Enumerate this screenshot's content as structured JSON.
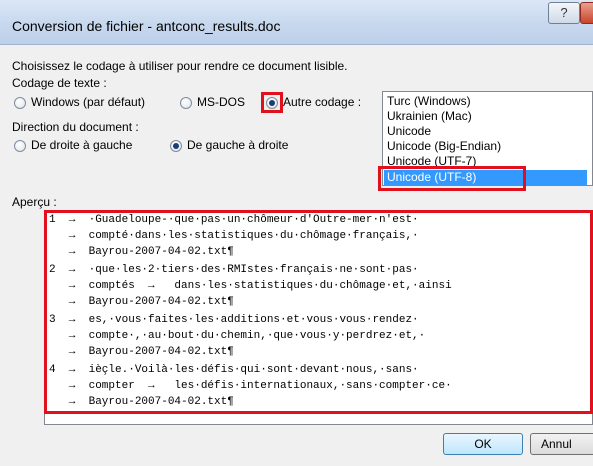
{
  "window": {
    "title": "Conversion de fichier - antconc_results.doc",
    "help_label": "?"
  },
  "instruction": "Choisissez le codage à utiliser pour rendre ce document lisible.",
  "encoding": {
    "label": "Codage de texte :",
    "windows_label": "Windows (par défaut)",
    "msdos_label": "MS-DOS",
    "other_label": "Autre codage :"
  },
  "direction": {
    "label": "Direction du document :",
    "rtl_label": "De droite à gauche",
    "ltr_label": "De gauche à droite"
  },
  "encoding_list": [
    "Turc (Windows)",
    "Ukrainien (Mac)",
    "Unicode",
    "Unicode (Big-Endian)",
    "Unicode (UTF-7)",
    "Unicode (UTF-8)"
  ],
  "preview": {
    "label": "Aperçu :",
    "lines": [
      "1  →  ·Guadeloupe-·que·pas·un·chômeur·d'Outre-mer·n'est·",
      "   →  compté·dans·les·statistiques·du·chômage·français,·",
      "   →  Bayrou-2007-04-02.txt¶",
      "2  →  ·que·les·2·tiers·des·RMIstes·français·ne·sont·pas·",
      "   →  comptés  →   dans·les·statistiques·du·chômage·et,·ainsi",
      "   →  Bayrou-2007-04-02.txt¶",
      "3  →  es,·vous·faites·les·additions·et·vous·vous·rendez·",
      "   →  compte·,·au·bout·du·chemin,·que·vous·y·perdrez·et,·",
      "   →  Bayrou-2007-04-02.txt¶",
      "4  →  ièçle.·Voilà·les·défis·qui·sont·devant·nous,·sans·",
      "   →  compter  →   les·défis·internationaux,·sans·compter·ce·",
      "   →  Bayrou-2007-04-02.txt¶"
    ]
  },
  "buttons": {
    "ok": "OK",
    "cancel": "Annul"
  }
}
